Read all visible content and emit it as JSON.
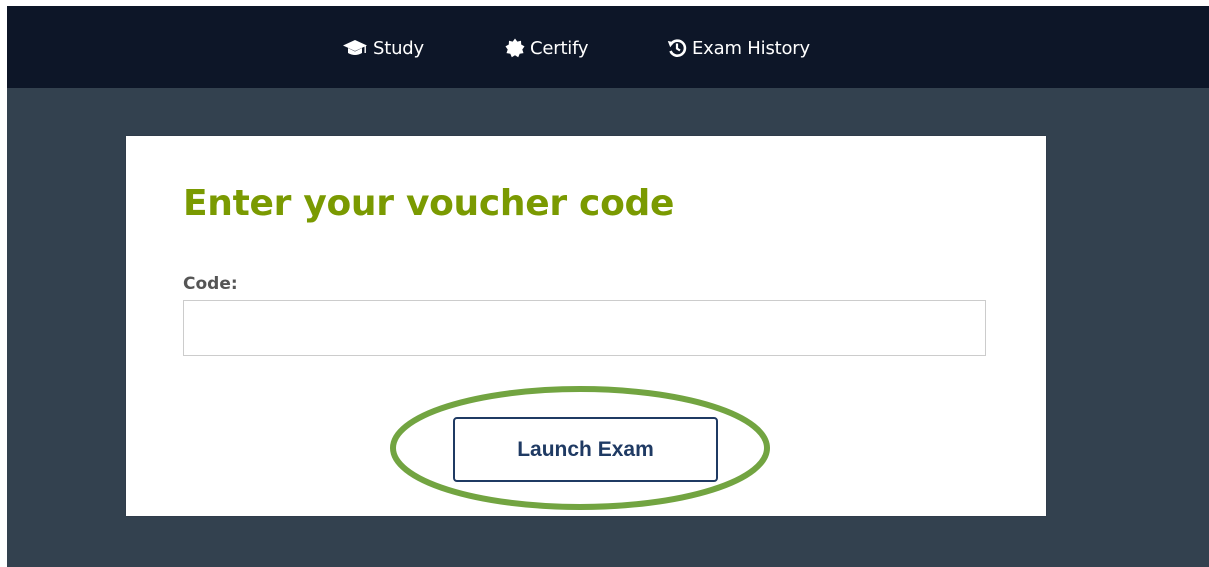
{
  "nav": {
    "items": [
      {
        "label": "Study",
        "icon": "graduation-cap-icon"
      },
      {
        "label": "Certify",
        "icon": "certificate-icon"
      },
      {
        "label": "Exam History",
        "icon": "history-icon"
      }
    ]
  },
  "voucher": {
    "title": "Enter your voucher code",
    "code_label": "Code:",
    "code_value": "",
    "launch_label": "Launch Exam"
  },
  "colors": {
    "nav_bg": "#0d1628",
    "page_bg": "#33414f",
    "title": "#7a9a01",
    "button": "#1f3a63",
    "highlight_ring": "#72a441"
  }
}
